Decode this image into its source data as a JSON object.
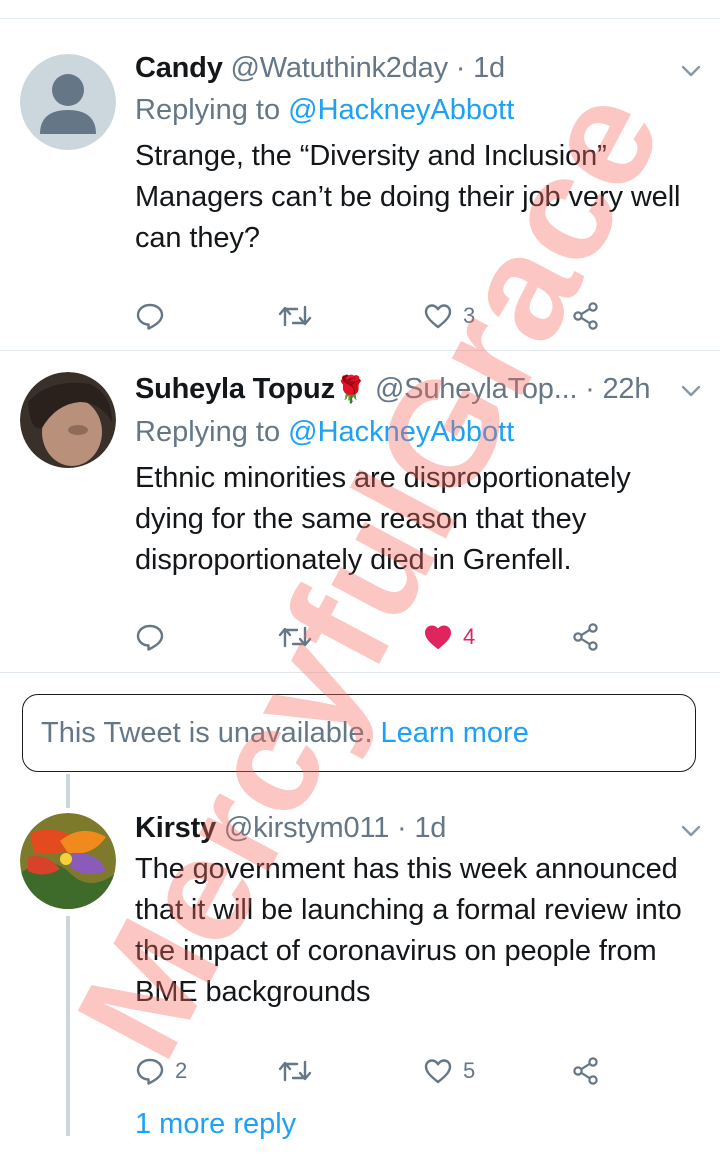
{
  "tweets": [
    {
      "name": "Candy",
      "handle": "@Watuthink2day",
      "time": "1d",
      "replying_prefix": "Replying to",
      "replying_to": "@HackneyAbbott",
      "text": "Strange, the “Diversity and Inclusion” Managers can’t be doing their job very well can they?",
      "replies": "",
      "retweets": "",
      "likes": "3"
    },
    {
      "name": "Suheyla Topuz",
      "name_emoji": "🌹",
      "handle": "@SuheylaTop...",
      "time": "22h",
      "replying_prefix": "Replying to",
      "replying_to": "@HackneyAbbott",
      "text": "Ethnic minorities are disproportionately dying for the same reason that they disproportionately died in Grenfell.",
      "replies": "",
      "retweets": "",
      "likes": "4"
    },
    {
      "name": "Kirsty",
      "handle": "@kirstym011",
      "time": "1d",
      "text": "The government has this week announced that it will be launching a formal review into the impact of coronavirus on people from BME backgrounds",
      "replies": "2",
      "retweets": "",
      "likes": "5"
    }
  ],
  "unavailable": {
    "text": "This Tweet is unavailable.",
    "link": "Learn more"
  },
  "more_reply": "1 more reply",
  "watermark": "MercyfulGrace",
  "colors": {
    "link_blue": "#1da1f2",
    "gray_text": "#657786",
    "like_red": "#e0245e",
    "divider": "#e1e8ed",
    "watermark": "#f8695f"
  },
  "icons": [
    "chevron-down-icon",
    "reply-icon",
    "retweet-icon",
    "like-icon",
    "share-icon"
  ]
}
